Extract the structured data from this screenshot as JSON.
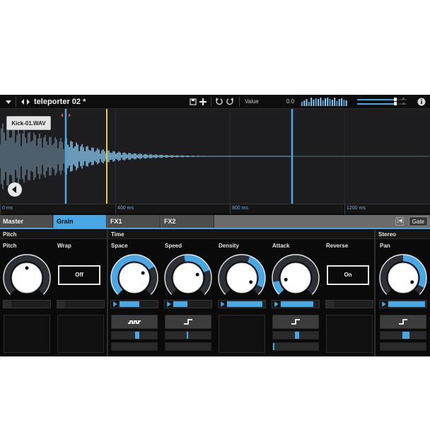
{
  "toolbar": {
    "preset_name": "teleporter 02 *",
    "value_label": "Value",
    "value_readout": "0.0"
  },
  "waveform": {
    "file_name": "Kick-01.WAV",
    "ruler_labels": [
      "0 ms",
      "400 ms",
      "800 ms",
      "1200 ms"
    ]
  },
  "tabs": {
    "items": [
      "Master",
      "Grain",
      "FX1",
      "FX2"
    ],
    "active": "Grain",
    "gate_label": "Gate"
  },
  "sections": {
    "pitch": "Pitch",
    "time": "Time",
    "stereo": "Stereo"
  },
  "params": {
    "pitch": {
      "label": "Pitch"
    },
    "wrap": {
      "label": "Wrap",
      "state": "Off"
    },
    "space": {
      "label": "Space"
    },
    "speed": {
      "label": "Speed"
    },
    "density": {
      "label": "Density"
    },
    "attack": {
      "label": "Attack"
    },
    "reverse": {
      "label": "Reverse",
      "state": "On"
    },
    "pan": {
      "label": "Pan"
    }
  },
  "colors": {
    "accent": "#49a7e4",
    "marker_yellow": "#e3d04a",
    "background": "#0a0a0a"
  }
}
